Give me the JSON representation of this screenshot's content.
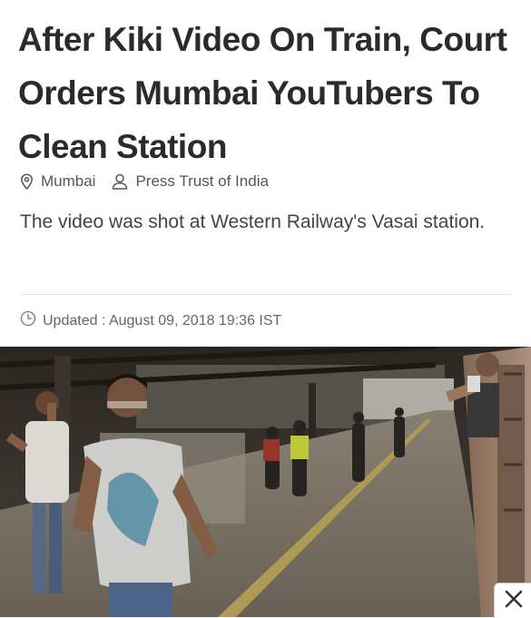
{
  "article": {
    "headline": "After Kiki Video On Train, Court Orders Mumbai YouTubers To Clean Station",
    "location": "Mumbai",
    "author": "Press Trust of India",
    "summary": "The video was shot at Western Railway's Vasai station.",
    "updated": "Updated : August 09, 2018 19:36 IST"
  },
  "icons": {
    "location": "location-pin-icon",
    "author": "user-icon",
    "updated": "clock-icon",
    "close": "close-icon"
  },
  "colors": {
    "headline": "#2b2b2b",
    "meta_text": "#555555",
    "divider": "#e3e3e3"
  }
}
